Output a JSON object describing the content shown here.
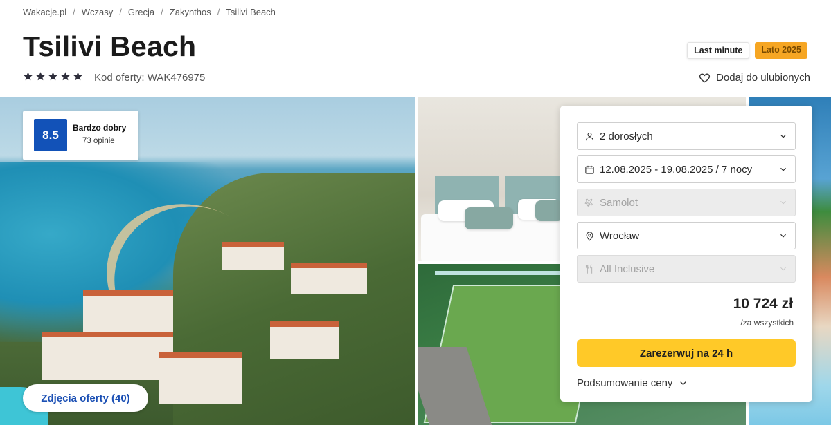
{
  "breadcrumb": [
    "Wakacje.pl",
    "Wczasy",
    "Grecja",
    "Zakynthos",
    "Tsilivi Beach"
  ],
  "hotel": {
    "name": "Tsilivi Beach",
    "stars": 5,
    "offer_code": "Kod oferty: WAK476975"
  },
  "badges": {
    "last_minute": "Last minute",
    "season": "Lato 2025"
  },
  "favorite_label": "Dodaj do ulubionych",
  "rating": {
    "score": "8.5",
    "label": "Bardzo dobry",
    "count": "73 opinie"
  },
  "photos_button": "Zdjęcia oferty (40)",
  "booking": {
    "travelers": "2 dorosłych",
    "dates": "12.08.2025 - 19.08.2025 / 7 nocy",
    "transport": "Samolot",
    "departure": "Wrocław",
    "board": "All Inclusive",
    "price": "10 724 zł",
    "price_note": "/za wszystkich",
    "book_label": "Zarezerwuj na 24 h",
    "summary_label": "Podsumowanie ceny"
  },
  "colors": {
    "rating_bg": "#1252b8",
    "book_button": "#ffc928",
    "season_badge": "#f6a623",
    "photos_button_text": "#1a4fb4"
  },
  "icons": {
    "travelers": "person-icon",
    "dates": "calendar-icon",
    "transport": "plane-icon",
    "departure": "location-pin-icon",
    "board": "cutlery-icon",
    "favorite": "heart-icon"
  }
}
